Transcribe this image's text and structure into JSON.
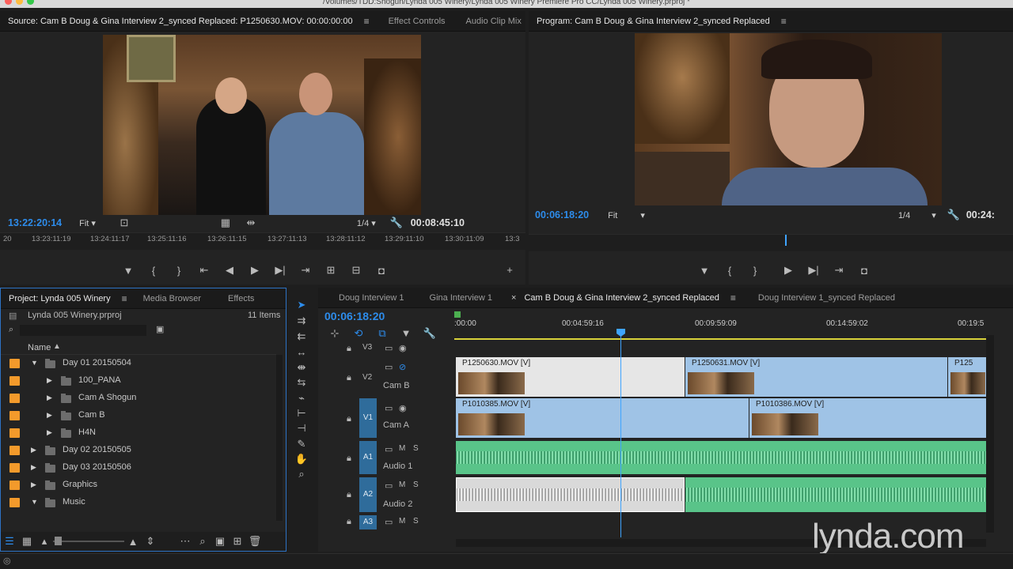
{
  "window": {
    "title": "/Volumes/TDD:Shogun/Lynda 005 Winery/Lynda 005 Winery Premiere Pro CC/Lynda 005 Winery.prproj *"
  },
  "colors": {
    "accent_blue": "#2d8ceb",
    "clip_video": "#9fc3e6",
    "clip_audio": "#59c489",
    "bin_label": "#f39a2b"
  },
  "source": {
    "tabs": [
      "Source: Cam B Doug & Gina Interview 2_synced Replaced: P1250630.MOV: 00:00:00:00",
      "Effect Controls",
      "Audio Clip Mix"
    ],
    "timecode": "13:22:20:14",
    "fit": "Fit",
    "resolution": "1/4",
    "duration": "00:08:45:10",
    "ruler": [
      "20",
      "13:23:11:19",
      "13:24:11:17",
      "13:25:11:16",
      "13:26:11:15",
      "13:27:11:13",
      "13:28:11:12",
      "13:29:11:10",
      "13:30:11:09",
      "13:3"
    ]
  },
  "program": {
    "title": "Program: Cam B Doug & Gina Interview 2_synced Replaced",
    "timecode": "00:06:18:20",
    "fit": "Fit",
    "resolution": "1/4",
    "duration": "00:24:"
  },
  "project": {
    "tabs": [
      "Project: Lynda 005 Winery",
      "Media Browser",
      "Effects"
    ],
    "file": "Lynda 005 Winery.prproj",
    "count": "11 Items",
    "column": "Name",
    "items": [
      {
        "label": "Day 01 20150504",
        "expanded": true,
        "indent": 0
      },
      {
        "label": "100_PANA",
        "expanded": false,
        "indent": 1
      },
      {
        "label": "Cam A Shogun",
        "expanded": false,
        "indent": 1
      },
      {
        "label": "Cam B",
        "expanded": false,
        "indent": 1
      },
      {
        "label": "H4N",
        "expanded": false,
        "indent": 1
      },
      {
        "label": "Day 02 20150505",
        "expanded": false,
        "indent": 0
      },
      {
        "label": "Day 03 20150506",
        "expanded": false,
        "indent": 0
      },
      {
        "label": "Graphics",
        "expanded": false,
        "indent": 0
      },
      {
        "label": "Music",
        "expanded": true,
        "indent": 0
      }
    ]
  },
  "timeline": {
    "tabs": [
      "Doug Interview 1",
      "Gina Interview 1",
      "Cam B Doug & Gina Interview 2_synced Replaced",
      "Doug Interview 1_synced Replaced"
    ],
    "timecode": "00:06:18:20",
    "ruler": [
      ":00:00",
      "00:04:59:16",
      "00:09:59:09",
      "00:14:59:02",
      "00:19:5"
    ],
    "tracks": {
      "v3": "V3",
      "v2": "V2",
      "v2_name": "Cam B",
      "v1": "V1",
      "v1_name": "Cam A",
      "a1": "A1",
      "a1_name": "Audio 1",
      "a2": "A2",
      "a2_name": "Audio 2",
      "a3": "A3",
      "m": "M",
      "s": "S"
    },
    "clips": {
      "v2_a": "P1250630.MOV [V]",
      "v2_b": "P1250631.MOV [V]",
      "v2_c": "P125",
      "v1_a": "P1010385.MOV [V]",
      "v1_b": "P1010386.MOV [V]"
    }
  },
  "watermark": "lynda.com"
}
